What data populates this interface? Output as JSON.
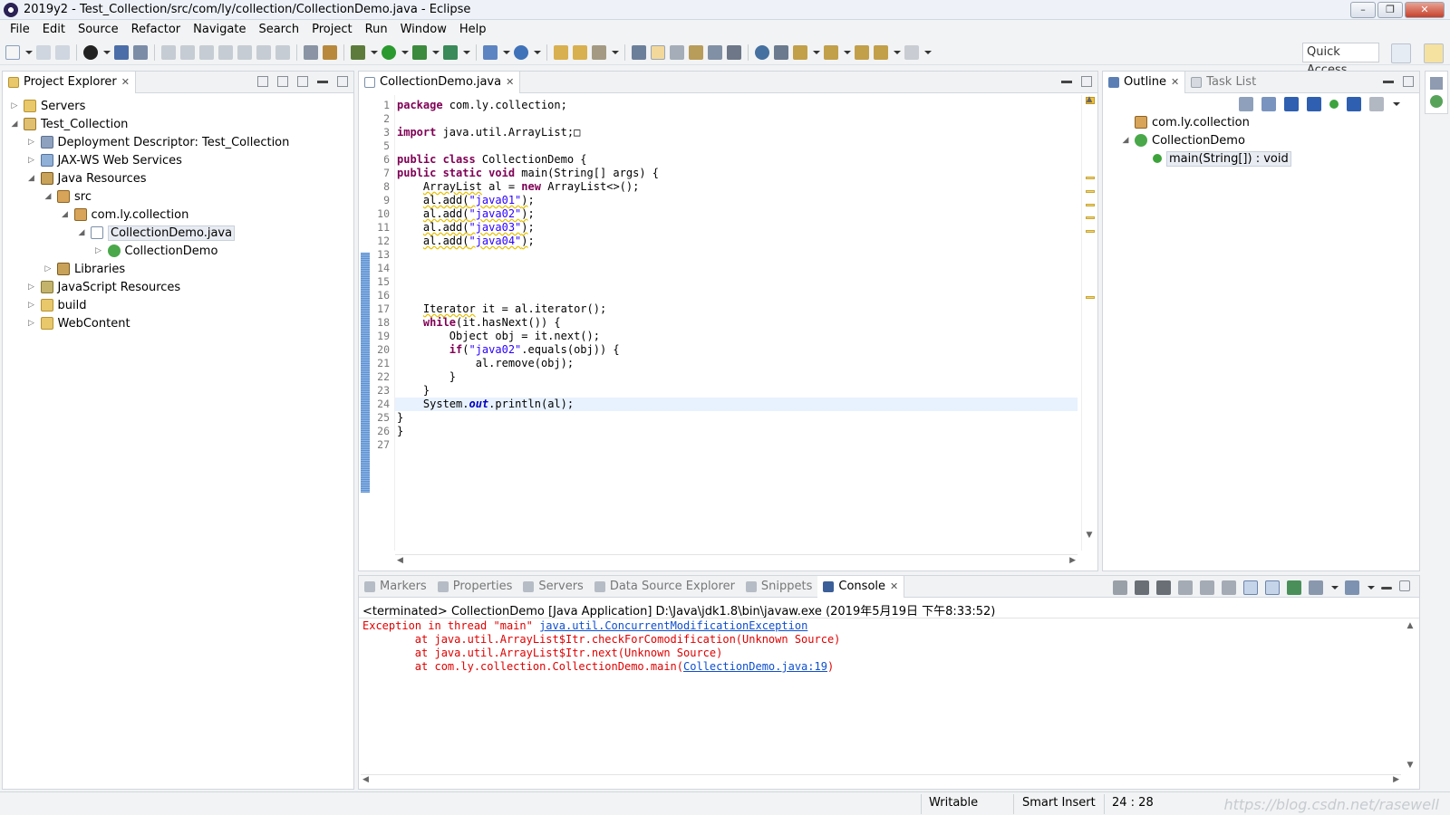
{
  "window": {
    "title": "2019y2 - Test_Collection/src/com/ly/collection/CollectionDemo.java - Eclipse"
  },
  "menu": [
    "File",
    "Edit",
    "Source",
    "Refactor",
    "Navigate",
    "Search",
    "Project",
    "Run",
    "Window",
    "Help"
  ],
  "quick_access": "Quick Access",
  "project_explorer": {
    "tab_label": "Project Explorer",
    "tree": [
      {
        "label": "Servers",
        "depth": 0,
        "expanded": false,
        "icon": "servers-folder-icon"
      },
      {
        "label": "Test_Collection",
        "depth": 0,
        "expanded": true,
        "icon": "project-icon"
      },
      {
        "label": "Deployment Descriptor: Test_Collection",
        "depth": 1,
        "expanded": false,
        "icon": "deployment-descriptor-icon"
      },
      {
        "label": "JAX-WS Web Services",
        "depth": 1,
        "expanded": false,
        "icon": "web-services-icon"
      },
      {
        "label": "Java Resources",
        "depth": 1,
        "expanded": true,
        "icon": "java-resources-icon"
      },
      {
        "label": "src",
        "depth": 2,
        "expanded": true,
        "icon": "source-folder-icon"
      },
      {
        "label": "com.ly.collection",
        "depth": 3,
        "expanded": true,
        "icon": "package-icon"
      },
      {
        "label": "CollectionDemo.java",
        "depth": 4,
        "expanded": true,
        "icon": "java-file-icon",
        "selected": true
      },
      {
        "label": "CollectionDemo",
        "depth": 5,
        "expanded": false,
        "icon": "class-icon"
      },
      {
        "label": "Libraries",
        "depth": 2,
        "expanded": false,
        "icon": "libraries-icon"
      },
      {
        "label": "JavaScript Resources",
        "depth": 1,
        "expanded": false,
        "icon": "javascript-resources-icon"
      },
      {
        "label": "build",
        "depth": 1,
        "expanded": false,
        "icon": "folder-icon"
      },
      {
        "label": "WebContent",
        "depth": 1,
        "expanded": false,
        "icon": "folder-icon"
      }
    ]
  },
  "editor": {
    "tab_label": "CollectionDemo.java",
    "cursor_line": 24,
    "lines": [
      {
        "n": "1",
        "html": "<span class=\"kw\">package</span> com.ly.collection;"
      },
      {
        "n": "2",
        "html": ""
      },
      {
        "n": "3",
        "html": "<span class=\"kw\">import</span> java.util.ArrayList;&#9633;"
      },
      {
        "n": "5",
        "html": ""
      },
      {
        "n": "6",
        "html": "<span class=\"kw\">public class</span> CollectionDemo {"
      },
      {
        "n": "7",
        "html": "<span class=\"kw\">public static void</span> main(String[] args) {"
      },
      {
        "n": "8",
        "html": "    <span class=\"warnline\">ArrayList</span> al = <span class=\"kw\">new</span> ArrayList&lt;&gt;();"
      },
      {
        "n": "9",
        "html": "    <span class=\"warnline\">al.add(<span class=\"str\">\"java01\"</span>)</span>;"
      },
      {
        "n": "10",
        "html": "    <span class=\"warnline\">al.add(<span class=\"str\">\"java02\"</span>)</span>;"
      },
      {
        "n": "11",
        "html": "    <span class=\"warnline\">al.add(<span class=\"str\">\"java03\"</span>)</span>;"
      },
      {
        "n": "12",
        "html": "    <span class=\"warnline\">al.add(<span class=\"str\">\"java04\"</span>)</span>;"
      },
      {
        "n": "13",
        "html": ""
      },
      {
        "n": "14",
        "html": ""
      },
      {
        "n": "15",
        "html": ""
      },
      {
        "n": "16",
        "html": ""
      },
      {
        "n": "17",
        "html": "    <span class=\"warnline\">Iterator</span> it = al.iterator();"
      },
      {
        "n": "18",
        "html": "    <span class=\"kw\">while</span>(it.hasNext()) {"
      },
      {
        "n": "19",
        "html": "        Object obj = it.next();"
      },
      {
        "n": "20",
        "html": "        <span class=\"kw\">if</span>(<span class=\"str\">\"java02\"</span>.equals(obj)) {"
      },
      {
        "n": "21",
        "html": "            al.remove(obj);"
      },
      {
        "n": "22",
        "html": "        }"
      },
      {
        "n": "23",
        "html": "    }"
      },
      {
        "n": "24",
        "html": "    System.<span class=\"fld\">out</span>.println(al);"
      },
      {
        "n": "25",
        "html": "}"
      },
      {
        "n": "26",
        "html": "}"
      },
      {
        "n": "27",
        "html": ""
      }
    ]
  },
  "outline": {
    "tabs": [
      "Outline",
      "Task List"
    ],
    "items": [
      {
        "label": "com.ly.collection",
        "depth": 0,
        "icon": "package-icon"
      },
      {
        "label": "CollectionDemo",
        "depth": 0,
        "icon": "class-icon",
        "expanded": true
      },
      {
        "label": "main(String[]) : void",
        "depth": 1,
        "icon": "method-icon",
        "selected": true
      }
    ]
  },
  "bottom_tabs": [
    {
      "label": "Markers",
      "icon": "markers-icon",
      "active": false
    },
    {
      "label": "Properties",
      "icon": "properties-icon",
      "active": false
    },
    {
      "label": "Servers",
      "icon": "servers-icon",
      "active": false
    },
    {
      "label": "Data Source Explorer",
      "icon": "data-source-icon",
      "active": false
    },
    {
      "label": "Snippets",
      "icon": "snippets-icon",
      "active": false
    },
    {
      "label": "Console",
      "icon": "console-icon",
      "active": true
    }
  ],
  "console": {
    "terminated": "<terminated> CollectionDemo [Java Application] D:\\Java\\jdk1.8\\bin\\javaw.exe (2019年5月19日 下午8:33:52)",
    "exception_prefix": "Exception in thread \"main\" ",
    "exception_link": "java.util.ConcurrentModificationException",
    "trace1": "        at java.util.ArrayList$Itr.checkForComodification(Unknown Source)",
    "trace2": "        at java.util.ArrayList$Itr.next(Unknown Source)",
    "trace3_prefix": "        at com.ly.collection.CollectionDemo.main(",
    "trace3_link": "CollectionDemo.java:19",
    "trace3_suffix": ")"
  },
  "status": {
    "writable": "Writable",
    "insert_mode": "Smart Insert",
    "position": "24 : 28"
  },
  "watermark": "https://blog.csdn.net/rasewell"
}
